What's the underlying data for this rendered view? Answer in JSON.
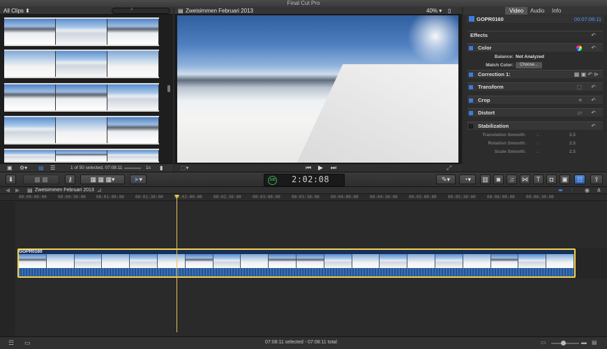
{
  "app": {
    "title": "Final Cut Pro"
  },
  "browser": {
    "filter_label": "All Clips",
    "selection_status": "1 of 50 selected, 07:08:11",
    "duration_label": "1s"
  },
  "viewer": {
    "project_title": "Zweisimmen Februari 2013",
    "zoom": "40%"
  },
  "inspector": {
    "tabs": [
      "Video",
      "Audio",
      "Info"
    ],
    "clip_name": "GOPR0160",
    "clip_duration": "00:07:08:11",
    "effects_label": "Effects",
    "sections": {
      "color": "Color",
      "correction": "Correction 1:",
      "transform": "Transform",
      "crop": "Crop",
      "distort": "Distort",
      "stabilization": "Stabilization"
    },
    "balance_label": "Balance:",
    "balance_value": "Not Analyzed",
    "match_color_label": "Match Color:",
    "choose_label": "Choose...",
    "translation_label": "Translation Smooth:",
    "translation_value": "2.5",
    "rotation_label": "Rotation Smooth:",
    "rotation_value": "2.5",
    "scale_label": "Scale Smooth:",
    "scale_value": "2.5"
  },
  "dashboard": {
    "percent": "100",
    "timecode": "2:02:08"
  },
  "timeline": {
    "project_title": "Zweisimmen Februari 2013",
    "ruler_ticks": [
      "00:00:00:00",
      "00:00:30:00",
      "00:01:00:00",
      "00:01:30:00",
      "00:02:00:00",
      "00:02:30:00",
      "00:03:00:00",
      "00:03:30:00",
      "00:04:00:00",
      "00:04:30:00",
      "00:05:00:00",
      "00:05:30:00",
      "00:06:00:00",
      "00:06:30:00"
    ],
    "clip_name": "GOPR0160",
    "status": "07:08:11 selected - 07:08:11 total"
  }
}
